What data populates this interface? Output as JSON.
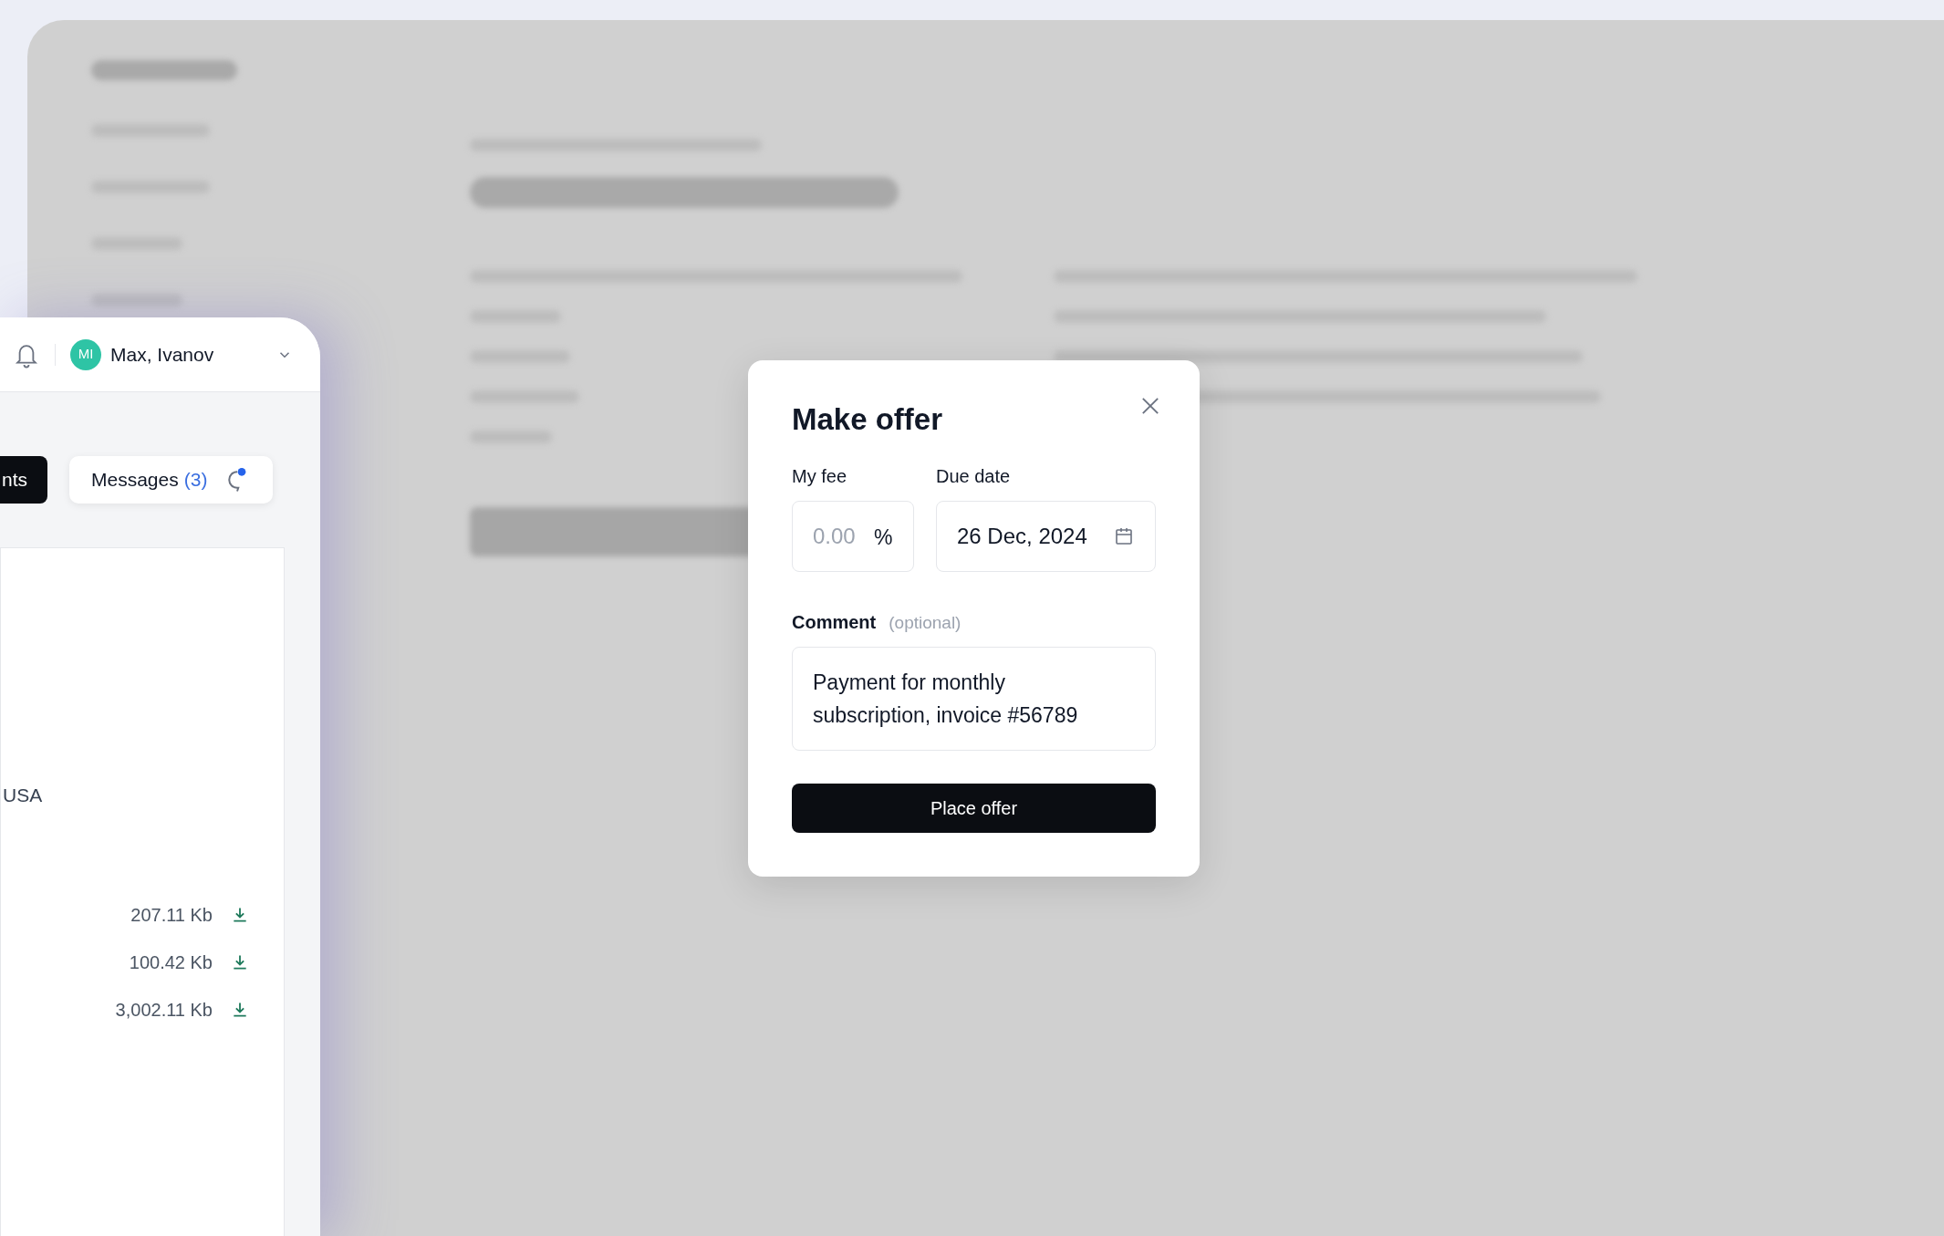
{
  "user": {
    "initials": "MI",
    "name": "Max, Ivanov"
  },
  "tabs": [
    {
      "label": "nts",
      "selected": true
    },
    {
      "label": "Messages",
      "count": "(3)",
      "selected": false
    }
  ],
  "details": {
    "location": "USA"
  },
  "files": [
    {
      "size": "207.11 Kb"
    },
    {
      "size": "100.42 Kb"
    },
    {
      "size": "3,002.11 Kb"
    }
  ],
  "modal": {
    "title": "Make offer",
    "fee": {
      "label": "My fee",
      "placeholder": "0.00",
      "suffix": "%"
    },
    "due_date": {
      "label": "Due date",
      "value": "26 Dec, 2024"
    },
    "comment": {
      "label": "Comment",
      "hint": "(optional)",
      "value": "Payment for monthly subscription, invoice #56789"
    },
    "submit": "Place offer"
  }
}
